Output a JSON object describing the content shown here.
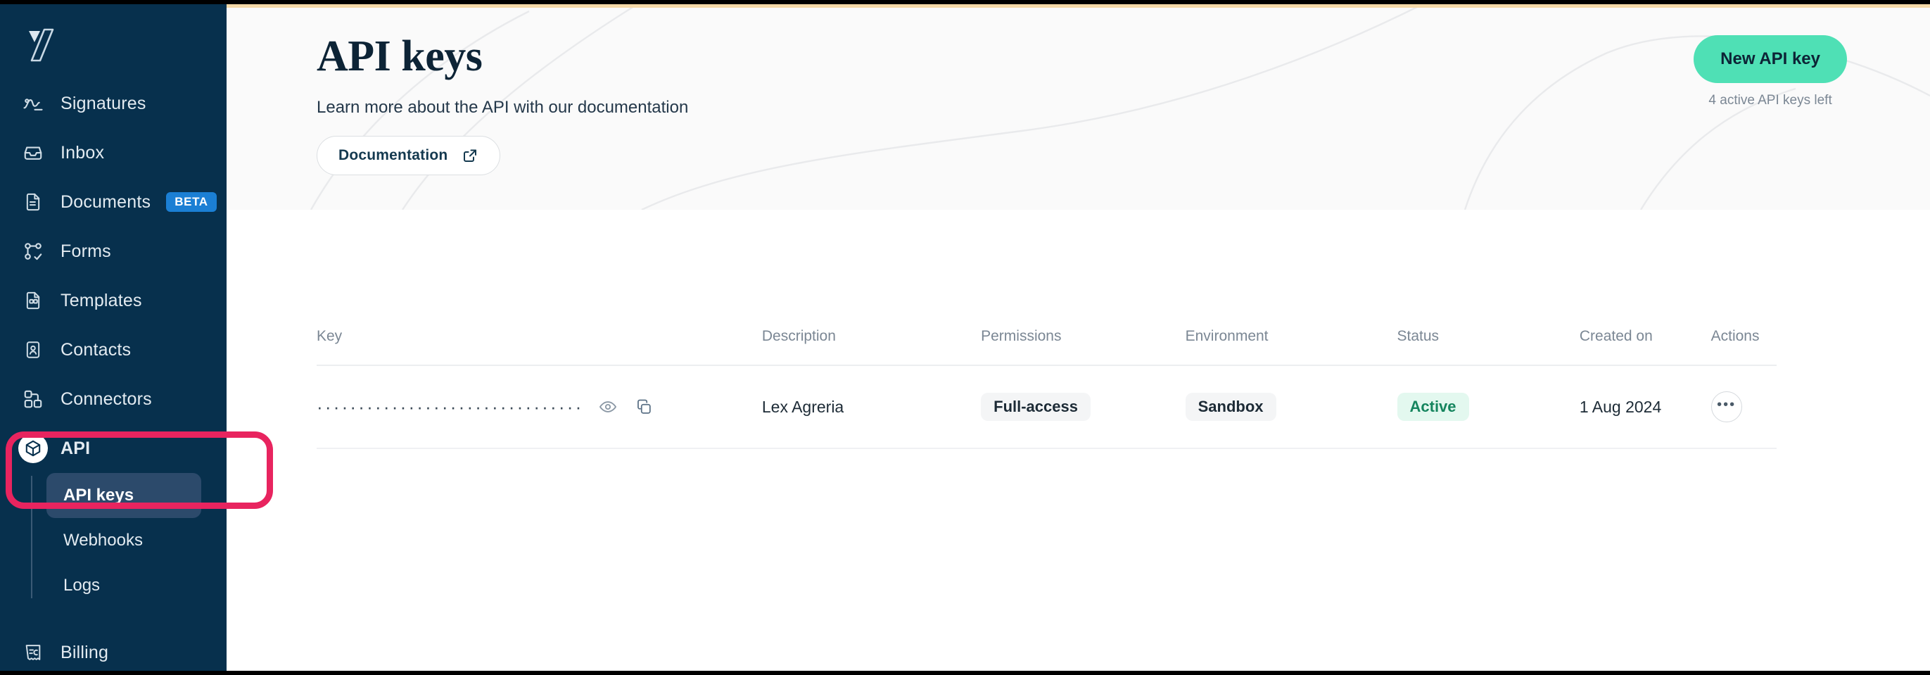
{
  "sidebar": {
    "logo_name": "yousign-logo",
    "items": [
      {
        "label": "Signatures",
        "icon": "signature-icon"
      },
      {
        "label": "Inbox",
        "icon": "inbox-icon"
      },
      {
        "label": "Documents",
        "icon": "document-icon",
        "badge": "BETA"
      },
      {
        "label": "Forms",
        "icon": "forms-icon"
      },
      {
        "label": "Templates",
        "icon": "templates-icon"
      },
      {
        "label": "Contacts",
        "icon": "contacts-icon"
      },
      {
        "label": "Connectors",
        "icon": "connectors-icon"
      },
      {
        "label": "API",
        "icon": "api-cube-icon"
      }
    ],
    "api_subitems": [
      {
        "label": "API keys",
        "active": true
      },
      {
        "label": "Webhooks",
        "active": false
      },
      {
        "label": "Logs",
        "active": false
      }
    ],
    "billing": {
      "label": "Billing",
      "icon": "billing-icon"
    }
  },
  "header": {
    "title": "API keys",
    "subtitle": "Learn more about the API with our documentation",
    "doc_button": {
      "label": "Documentation",
      "icon": "external-link-icon"
    },
    "new_key_button": "New API key",
    "keys_left_note": "4 active API keys left"
  },
  "table": {
    "columns": [
      "Key",
      "Description",
      "Permissions",
      "Environment",
      "Status",
      "Created on",
      "Actions"
    ],
    "rows": [
      {
        "key_masked": "································",
        "reveal_icon": "eye-icon",
        "copy_icon": "copy-icon",
        "description": "Lex Agreria",
        "permissions": "Full-access",
        "environment": "Sandbox",
        "status": "Active",
        "created_on": "1 Aug 2024",
        "actions_icon": "ellipsis-icon"
      }
    ]
  },
  "colors": {
    "sidebar_bg": "#07304d",
    "sidebar_active": "#2c4a6b",
    "accent_green": "#4fe0b5",
    "beta_blue": "#1b7fd4",
    "highlight_pink": "#e8245f",
    "status_green_text": "#15855e",
    "status_green_bg": "#e3f8ef",
    "header_bg": "#fafafa"
  }
}
